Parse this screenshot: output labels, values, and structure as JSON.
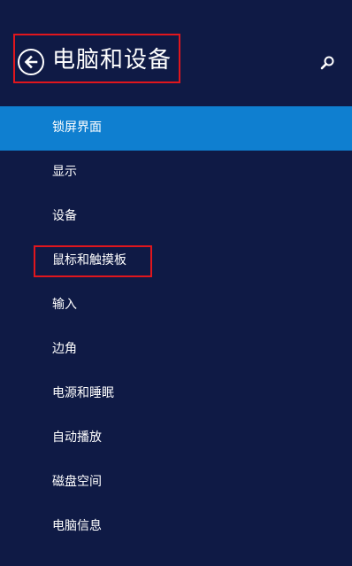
{
  "header": {
    "title": "电脑和设备",
    "back_icon": "back-arrow-icon",
    "search_icon": "search-icon"
  },
  "nav": {
    "items": [
      {
        "label": "锁屏界面",
        "selected": true
      },
      {
        "label": "显示",
        "selected": false
      },
      {
        "label": "设备",
        "selected": false
      },
      {
        "label": "鼠标和触摸板",
        "selected": false,
        "highlighted": true
      },
      {
        "label": "输入",
        "selected": false
      },
      {
        "label": "边角",
        "selected": false
      },
      {
        "label": "电源和睡眠",
        "selected": false
      },
      {
        "label": "自动播放",
        "selected": false
      },
      {
        "label": "磁盘空间",
        "selected": false
      },
      {
        "label": "电脑信息",
        "selected": false
      }
    ]
  },
  "colors": {
    "background": "#0f1a45",
    "selected": "#0f7fd0",
    "annotation": "#e0161d",
    "text": "#ffffff"
  }
}
